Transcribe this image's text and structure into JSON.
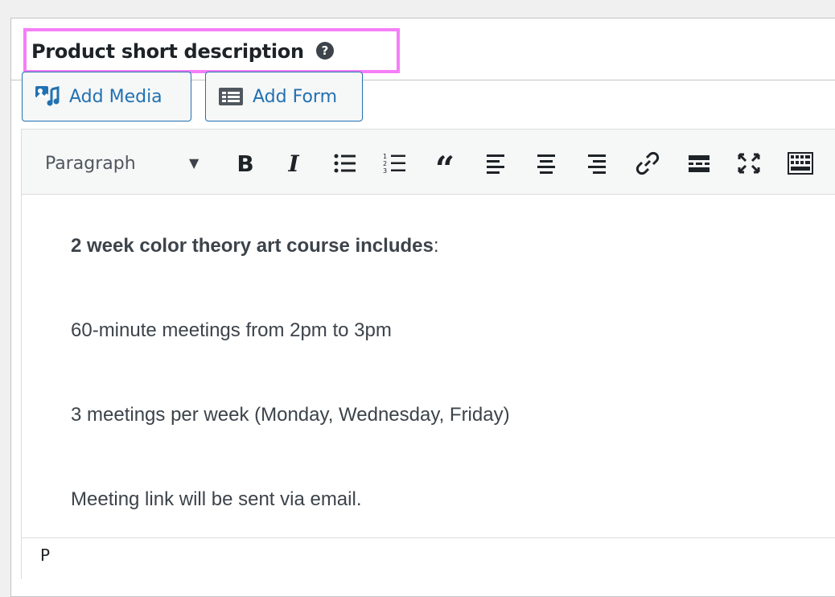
{
  "panel": {
    "title": "Product short description",
    "help_icon_glyph": "?",
    "highlight_color": "#f57ef7"
  },
  "media_buttons": {
    "add_media_label": "Add Media",
    "add_media_icon": "media-icon",
    "add_form_label": "Add Form",
    "add_form_icon": "form-icon"
  },
  "toolbar": {
    "format_select_value": "Paragraph",
    "bold_label": "B",
    "italic_label": "I",
    "buttons": [
      "bold-icon",
      "italic-icon",
      "bulleted-list-icon",
      "numbered-list-icon",
      "blockquote-icon",
      "align-left-icon",
      "align-center-icon",
      "align-right-icon",
      "link-icon",
      "read-more-icon",
      "fullscreen-icon",
      "toolbar-toggle-icon"
    ]
  },
  "content": {
    "heading_bold": "2 week color theory art course includes",
    "heading_suffix": ":",
    "line1": "60-minute meetings from 2pm to 3pm",
    "line2": "3 meetings per week (Monday, Wednesday, Friday)",
    "line3": "Meeting link will be sent via email."
  },
  "status": {
    "path": "P"
  },
  "colors": {
    "accent": "#2271b1",
    "text": "#3c434a",
    "highlight": "#f57ef7"
  }
}
